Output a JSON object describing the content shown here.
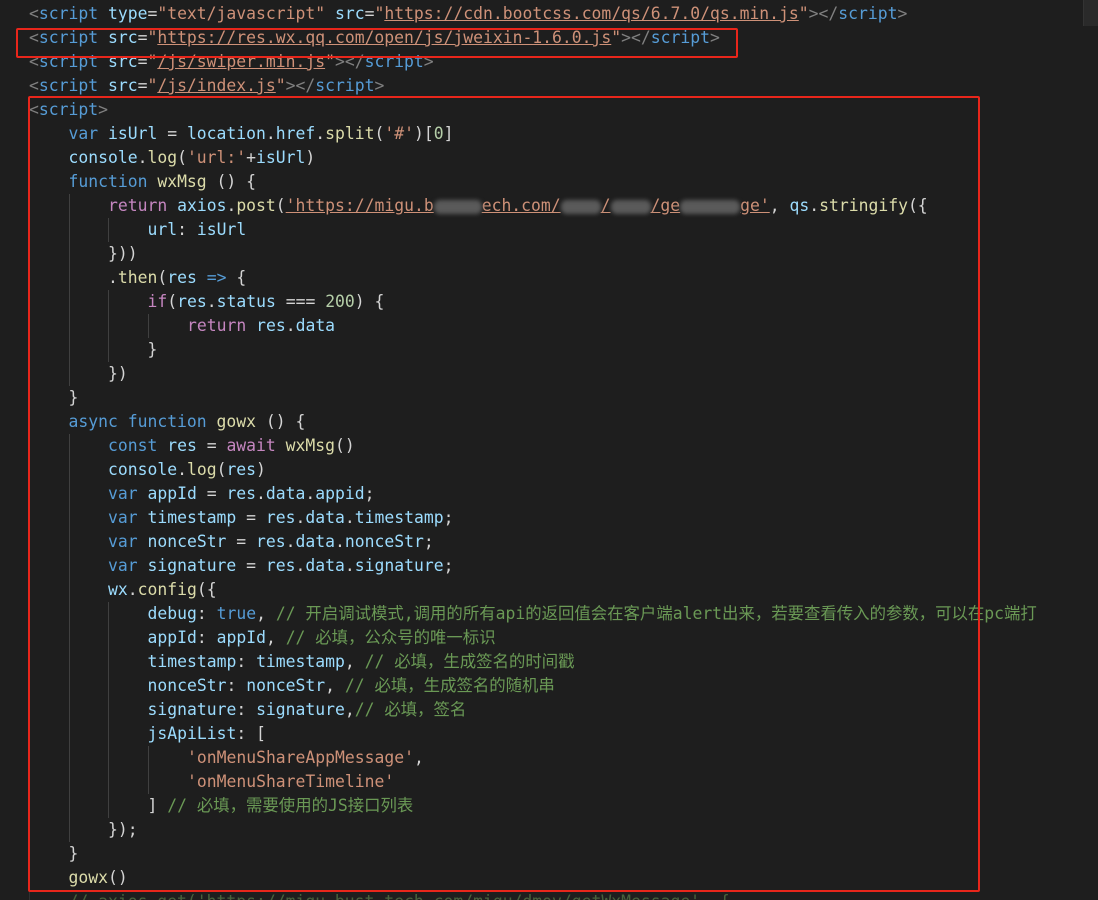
{
  "editor": {
    "theme_colors": {
      "background": "#1e1e1e",
      "tag": "#808080",
      "tag_name": "#569cd6",
      "attribute": "#9cdcfe",
      "string": "#ce9178",
      "keyword": "#569cd6",
      "control_keyword": "#c586c0",
      "function": "#dcdcaa",
      "variable": "#9cdcfe",
      "number": "#b5cea8",
      "comment": "#6a9955",
      "highlight_box": "#e8261b"
    },
    "lines": {
      "l1": {
        "src_attr": "src",
        "url": "https://cdn.bootcss.com/qs/6.7.0/qs.min.js",
        "type_attr": "type",
        "type_val": "\"text/javascript\""
      },
      "l2": {
        "src_attr": "src",
        "url": "https://res.wx.qq.com/open/js/jweixin-1.6.0.js"
      },
      "l3": {
        "src_attr": "src",
        "url": "/js/swiper.min.js"
      },
      "l4": {
        "src_attr": "src",
        "url": "/js/index.js"
      },
      "l5": {
        "tag": "script"
      },
      "l6": {
        "kw": "var",
        "name": "isUrl",
        "rest1": "location",
        "rest2": "href",
        "rest3": "split",
        "str": "'#'",
        "idx": "0"
      },
      "l7": {
        "obj": "console",
        "fn": "log",
        "str": "'url:'",
        "var": "isUrl"
      },
      "l8": {
        "kw": "function",
        "fn": "wxMsg",
        "rest": " () {"
      },
      "l9": {
        "kw": "return",
        "obj": "axios",
        "fn": "post",
        "url_a": "'https://migu.b",
        "url_b": "ech.com/",
        "url_c": "/",
        "url_d": "/ge",
        "url_e": "ge'",
        "obj2": "qs",
        "fn2": "stringify"
      },
      "l10": {
        "key": "url",
        "var": "isUrl"
      },
      "l11": {
        "text": "}))"
      },
      "l12": {
        "fn": "then",
        "param": "res",
        "arrow": "=>"
      },
      "l13": {
        "kw": "if",
        "obj": "res",
        "prop": "status",
        "op": "===",
        "num": "200"
      },
      "l14": {
        "kw": "return",
        "obj": "res",
        "prop": "data"
      },
      "l15": {
        "text": "}"
      },
      "l16": {
        "text": "})"
      },
      "l17": {
        "text": "}"
      },
      "l18": {
        "kw1": "async",
        "kw2": "function",
        "fn": "gowx",
        "rest": " () {"
      },
      "l19": {
        "kw": "const",
        "name": "res",
        "kw2": "await",
        "fn": "wxMsg"
      },
      "l20": {
        "obj": "console",
        "fn": "log",
        "var": "res"
      },
      "l21": {
        "kw": "var",
        "name": "appId",
        "path_a": "res",
        "path_b": "data",
        "path_c": "appid"
      },
      "l22": {
        "kw": "var",
        "name": "timestamp",
        "path_a": "res",
        "path_b": "data",
        "path_c": "timestamp"
      },
      "l23": {
        "kw": "var",
        "name": "nonceStr",
        "path_a": "res",
        "path_b": "data",
        "path_c": "nonceStr"
      },
      "l24": {
        "kw": "var",
        "name": "signature",
        "path_a": "res",
        "path_b": "data",
        "path_c": "signature"
      },
      "l25": {
        "obj": "wx",
        "fn": "config"
      },
      "l26": {
        "key": "debug",
        "val": "true",
        "comment": "// 开启调试模式,调用的所有api的返回值会在客户端alert出来，若要查看传入的参数，可以在pc端打"
      },
      "l27": {
        "key": "appId",
        "val": "appId",
        "comment": "// 必填，公众号的唯一标识"
      },
      "l28": {
        "key": "timestamp",
        "val": "timestamp",
        "comment": "// 必填，生成签名的时间戳"
      },
      "l29": {
        "key": "nonceStr",
        "val": "nonceStr",
        "comment": "// 必填，生成签名的随机串"
      },
      "l30": {
        "key": "signature",
        "val": "signature",
        "comment": "// 必填，签名"
      },
      "l31": {
        "key": "jsApiList"
      },
      "l32": {
        "str": "'onMenuShareAppMessage'"
      },
      "l33": {
        "str": "'onMenuShareTimeline'"
      },
      "l34": {
        "comment": "// 必填，需要使用的JS接口列表"
      },
      "l35": {
        "text": "});"
      },
      "l36": {
        "text": "}"
      },
      "l37": {
        "fn": "gowx",
        "rest": "()"
      },
      "l38": {
        "text": "// axios.get('https://migu.bust-tech.com/migu/dmov/getWxMessage', {"
      }
    }
  }
}
